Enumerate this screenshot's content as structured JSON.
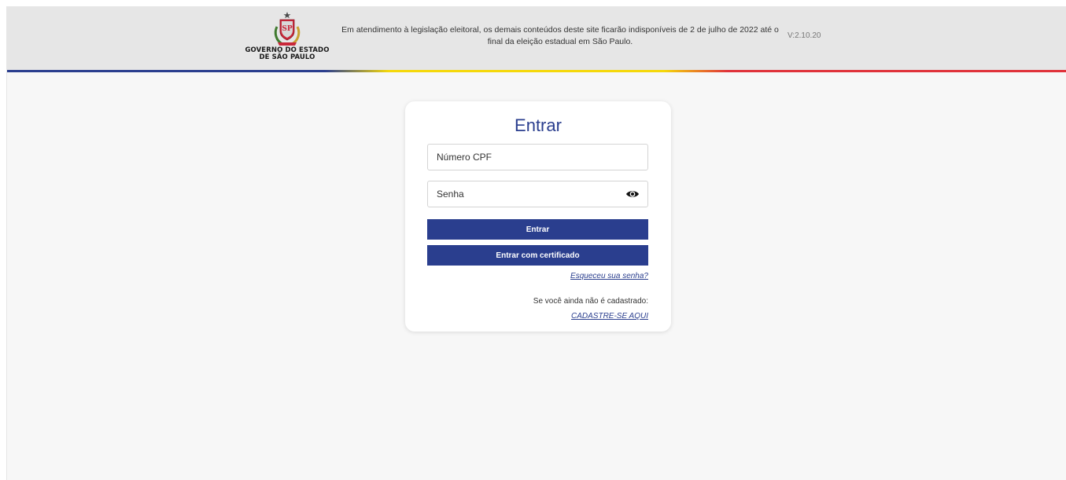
{
  "header": {
    "logo_line1": "GOVERNO DO ESTADO",
    "logo_line2": "DE SÃO PAULO",
    "notice": "Em atendimento à legislação eleitoral, os demais conteúdos deste site ficarão indisponíveis de 2 de julho de 2022 até o final da eleição estadual em São Paulo.",
    "version": "V:2.10.20"
  },
  "login": {
    "title": "Entrar",
    "cpf_placeholder": "Número CPF",
    "cpf_value": "",
    "password_placeholder": "Senha",
    "password_value": "",
    "login_button": "Entrar",
    "certificate_button": "Entrar com certificado",
    "forgot_link": "Esqueceu sua senha?",
    "register_hint": "Se você ainda não é cadastrado:",
    "register_link": "CADASTRE-SE AQUI"
  },
  "icons": {
    "logo": "sao-paulo-coat-of-arms",
    "password_toggle": "eye-icon"
  },
  "colors": {
    "brand_blue": "#2a3e8e",
    "stripe_blue": "#2a3e8e",
    "stripe_yellow": "#f5d80a",
    "stripe_red": "#e0323a",
    "header_bg": "#e6e6e6",
    "page_bg": "#f7f7f7"
  }
}
